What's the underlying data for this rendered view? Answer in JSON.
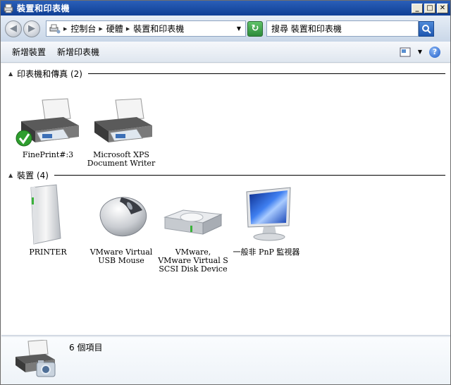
{
  "window": {
    "title": "裝置和印表機",
    "minimize_label": "_",
    "maximize_label": "□",
    "close_label": "✕"
  },
  "address": {
    "crumbs": [
      "控制台",
      "硬體",
      "裝置和印表機"
    ],
    "search_placeholder": "搜尋 裝置和印表機"
  },
  "toolbar": {
    "add_device": "新增裝置",
    "add_printer": "新增印表機",
    "help_label": "?"
  },
  "groups": [
    {
      "title": "印表機和傳真 (2)",
      "items": [
        {
          "label": "FinePrint#:3",
          "icon": "printer-icon",
          "default": true
        },
        {
          "label": "Microsoft XPS Document Writer",
          "icon": "printer-icon",
          "default": false
        }
      ]
    },
    {
      "title": "裝置 (4)",
      "items": [
        {
          "label": "PRINTER",
          "icon": "computer-tower-icon"
        },
        {
          "label": "VMware Virtual USB Mouse",
          "icon": "mouse-icon"
        },
        {
          "label": "VMware, VMware Virtual S SCSI Disk Device",
          "icon": "hard-disk-icon"
        },
        {
          "label": "一般非 PnP 監視器",
          "icon": "monitor-icon"
        }
      ]
    }
  ],
  "details": {
    "count_text": "6 個項目"
  },
  "colors": {
    "titlebar": "#1f52a8",
    "content_bg": "#ffffff",
    "default_check": "#2e9e2e"
  }
}
